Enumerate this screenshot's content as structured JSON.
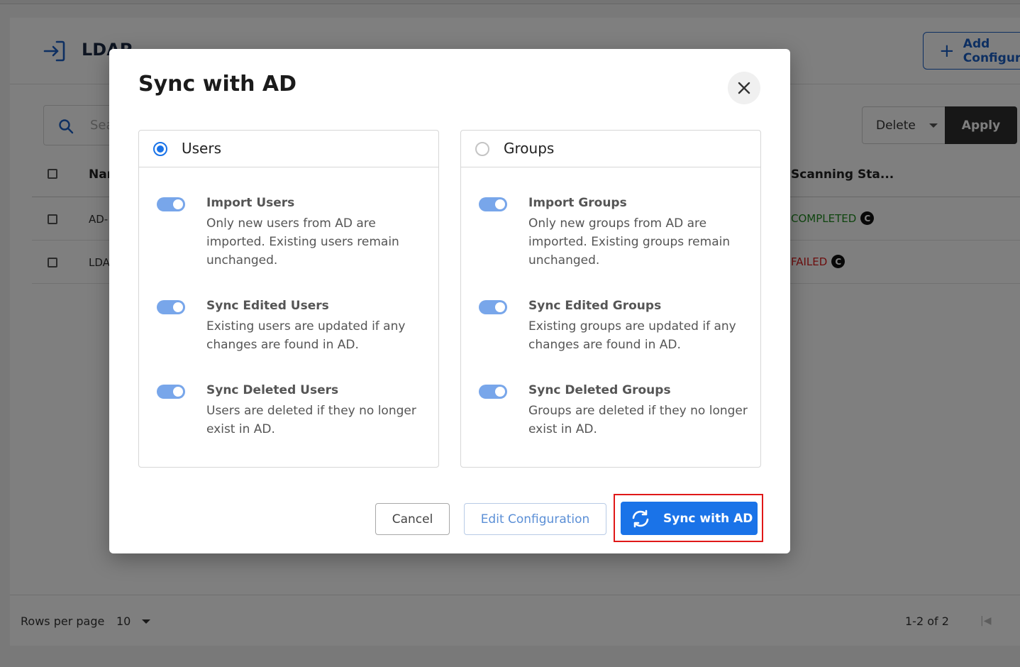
{
  "page": {
    "title": "LDAP",
    "add_button_label": "Add Configuration",
    "search_placeholder": "Search",
    "bulk_action": "Delete",
    "apply_label": "Apply",
    "table": {
      "columns": [
        "Name",
        "Scanning Sta..."
      ],
      "rows": [
        {
          "name": "AD-",
          "status": "COMPLETED"
        },
        {
          "name": "LDA",
          "status": "FAILED"
        }
      ]
    },
    "pagination": {
      "rows_per_page_label": "Rows per page",
      "rows_per_page_value": "10",
      "range": "1-2 of 2"
    }
  },
  "modal": {
    "title": "Sync with AD",
    "users": {
      "label": "Users",
      "selected": true,
      "options": [
        {
          "title": "Import Users",
          "description": "Only new users from AD are imported. Existing users remain unchanged.",
          "enabled": true
        },
        {
          "title": "Sync Edited Users",
          "description": "Existing users are updated if any changes are found in AD.",
          "enabled": true
        },
        {
          "title": "Sync Deleted Users",
          "description": "Users are deleted if they no longer exist in AD.",
          "enabled": true
        }
      ]
    },
    "groups": {
      "label": "Groups",
      "selected": false,
      "options": [
        {
          "title": "Import Groups",
          "description": "Only new groups from AD are imported. Existing groups remain unchanged.",
          "enabled": true
        },
        {
          "title": "Sync Edited Groups",
          "description": "Existing groups are updated if any changes are found in AD.",
          "enabled": true
        },
        {
          "title": "Sync Deleted Groups",
          "description": "Groups are deleted if they no longer exist in AD.",
          "enabled": true
        }
      ]
    },
    "buttons": {
      "cancel": "Cancel",
      "edit": "Edit Configuration",
      "sync": "Sync with AD"
    }
  },
  "colors": {
    "primary": "#1a73e8",
    "toggle_on": "#78a6ea",
    "completed": "#1f8a1f",
    "failed": "#d91c1c",
    "highlight": "#e01818"
  }
}
